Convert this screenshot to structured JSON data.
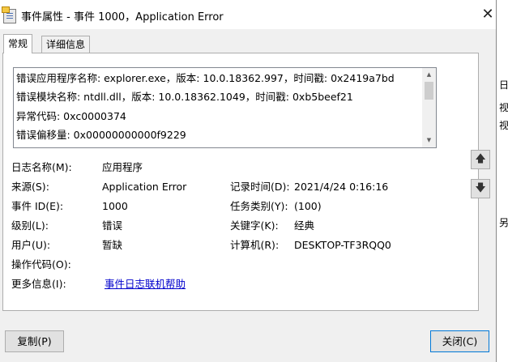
{
  "window": {
    "title": "事件属性 - 事件 1000，Application Error",
    "close_glyph": "✕"
  },
  "tabs": [
    {
      "label": "常规"
    },
    {
      "label": "详细信息"
    }
  ],
  "description": {
    "lines": [
      "错误应用程序名称: explorer.exe，版本: 10.0.18362.997，时间戳: 0x2419a7bd",
      "错误模块名称: ntdll.dll，版本: 10.0.18362.1049，时间戳: 0xb5beef21",
      "异常代码: 0xc0000374",
      "错误偏移量: 0x00000000000f9229"
    ]
  },
  "fields": {
    "log_name_label": "日志名称(M):",
    "log_name_value": "应用程序",
    "source_label": "来源(S):",
    "source_value": "Application Error",
    "logged_label": "记录时间(D):",
    "logged_value": "2021/4/24 0:16:16",
    "event_id_label": "事件 ID(E):",
    "event_id_value": "1000",
    "task_category_label": "任务类别(Y):",
    "task_category_value": "(100)",
    "level_label": "级别(L):",
    "level_value": "错误",
    "keywords_label": "关键字(K):",
    "keywords_value": "经典",
    "user_label": "用户(U):",
    "user_value": "暂缺",
    "computer_label": "计算机(R):",
    "computer_value": "DESKTOP-TF3RQQ0",
    "opcode_label": "操作代码(O):",
    "more_info_label": "更多信息(I):",
    "more_info_link": "事件日志联机帮助"
  },
  "nav": {
    "up_glyph": "🡅",
    "down_glyph": "🡇"
  },
  "buttons": {
    "copy": "复制(P)",
    "close": "关闭(C)"
  },
  "background_window": {
    "fragments": [
      "日",
      "视",
      "视",
      "另"
    ]
  }
}
